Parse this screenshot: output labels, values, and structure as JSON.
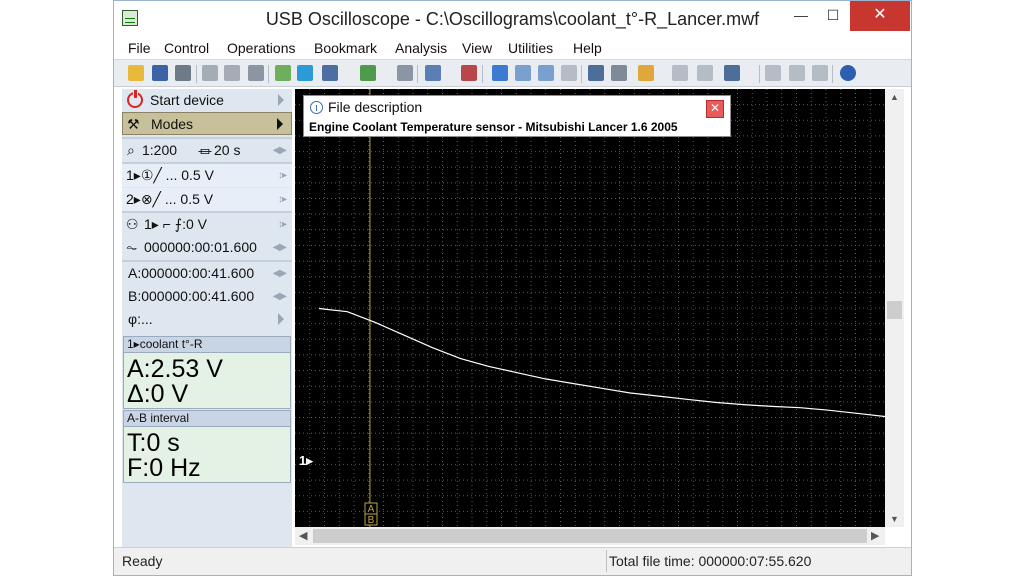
{
  "window": {
    "title": "USB Oscilloscope - C:\\Oscillograms\\coolant_t°-R_Lancer.mwf",
    "minimize": "—",
    "maximize": "☐",
    "close": "✕"
  },
  "menu": [
    "File",
    "Control",
    "Operations",
    "Bookmark",
    "Analysis",
    "View",
    "Utilities",
    "Help"
  ],
  "left_panel": {
    "start_device": "Start device",
    "modes": "Modes",
    "scale": "1:200",
    "time_window": "20 s",
    "channel1": "1▸①╱ ... 0.5 V",
    "channel2": "2▸⊗╱ ... 0.5 V",
    "trigger": "1▸ ⌐ ⨍:0 V",
    "period": "000000:00:01.600",
    "cursor_a": "A:000000:00:41.600",
    "cursor_b": "B:000000:00:41.600",
    "phi": "φ:..."
  },
  "measure_channel": {
    "header": "1▸coolant t°-R",
    "value_a": "A:2.53 V",
    "delta": "Δ:0 V"
  },
  "measure_interval": {
    "header": "A-B interval",
    "period": "T:0 s",
    "frequency": "F:0 Hz"
  },
  "scope": {
    "channel_marker": "1▸",
    "cursor_label_a": "A",
    "cursor_label_b": "B",
    "background": "#000000",
    "grid_color": "#5a5a5a",
    "trace_color": "#ffffff",
    "cursor_color": "#b8a640"
  },
  "file_description": {
    "title": "File description",
    "text": "Engine Coolant Temperature sensor - Mitsubishi Lancer 1.6 2005",
    "close": "✕"
  },
  "status": {
    "left": "Ready",
    "right": "Total file time: 000000:07:55.620"
  },
  "chart_data": {
    "type": "line",
    "x_divisions": 20,
    "y_divisions": 14,
    "x_range": [
      0,
      20
    ],
    "x_unit": "s",
    "series": [
      {
        "x": [
          0,
          1,
          2,
          3,
          4,
          5,
          6,
          7,
          8,
          9,
          10,
          11,
          12,
          13,
          14,
          15,
          16,
          17,
          18,
          19,
          20
        ],
        "y_div": [
          4.65,
          4.55,
          4.2,
          3.8,
          3.4,
          3.05,
          2.8,
          2.6,
          2.4,
          2.25,
          2.1,
          1.95,
          1.85,
          1.75,
          1.65,
          1.58,
          1.52,
          1.48,
          1.4,
          1.3,
          1.2
        ]
      }
    ],
    "cursor_x": 1.8,
    "grid": true
  }
}
